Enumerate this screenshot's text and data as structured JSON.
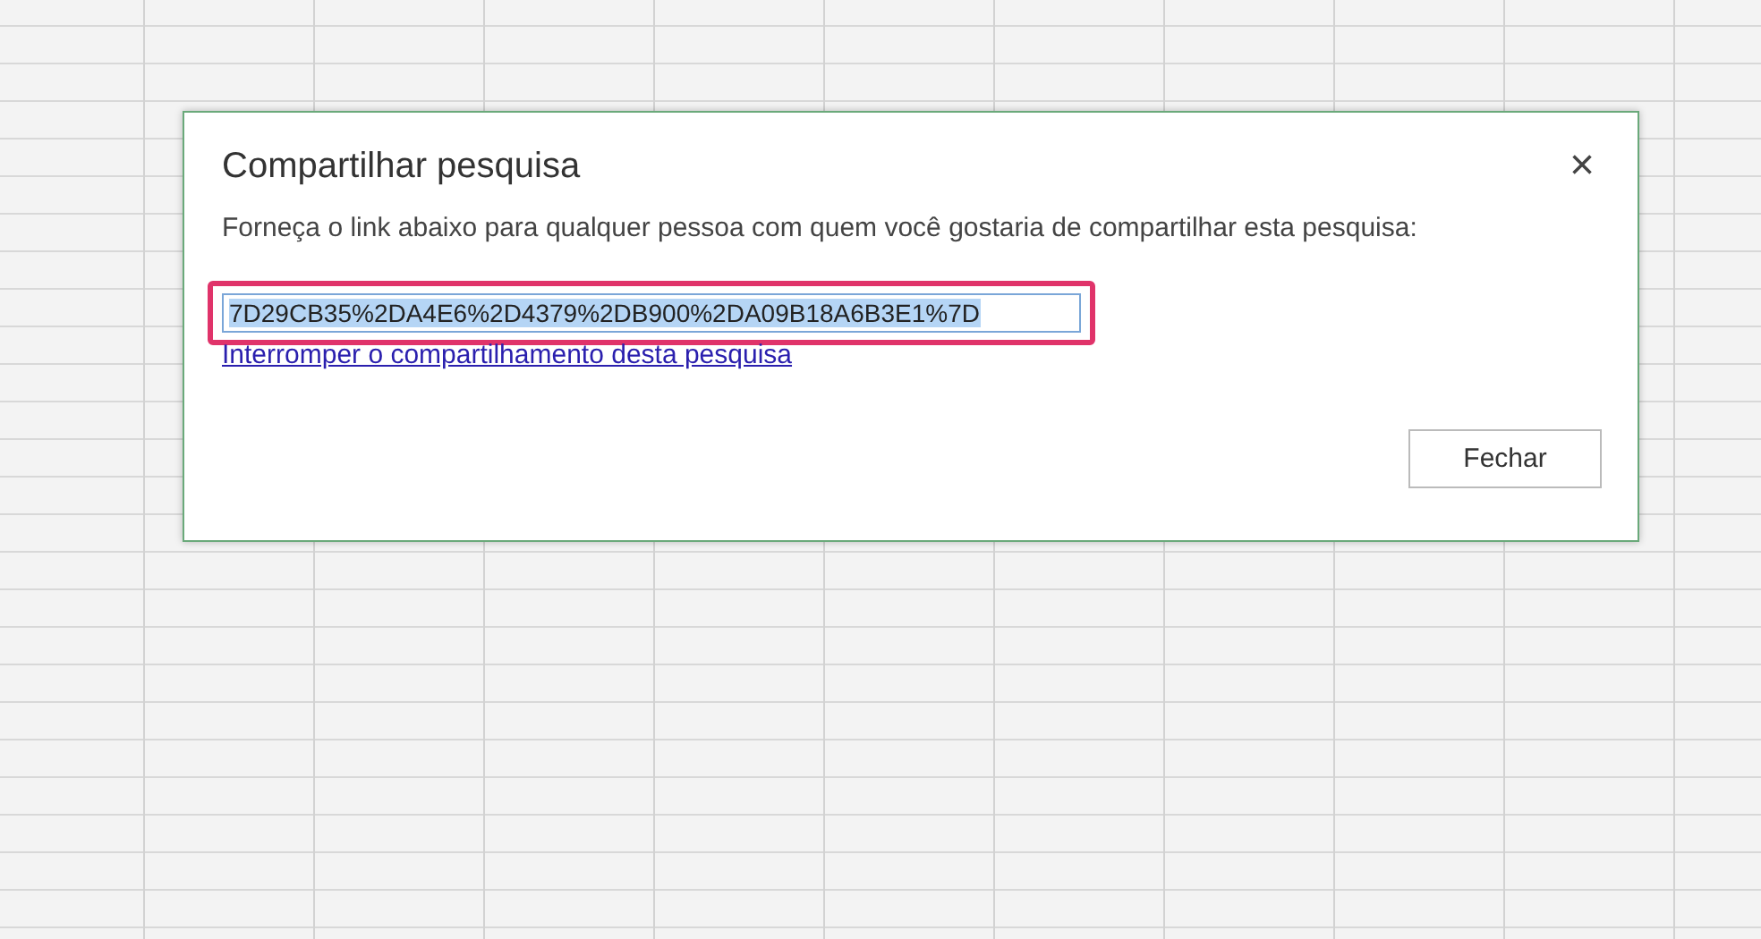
{
  "dialog": {
    "title": "Compartilhar pesquisa",
    "close": "×",
    "message": "Forneça o link abaixo para qualquer pessoa com quem você gostaria de compartilhar esta pesquisa:",
    "link_field": {
      "value": "7D29CB35%2DA4E6%2D4379%2DB900%2DA09B18A6B3E1%7D",
      "selected": true,
      "highlighted": true
    },
    "stop_sharing_link": "Interromper o compartilhamento desta pesquisa",
    "buttons": [
      "Fechar"
    ]
  }
}
